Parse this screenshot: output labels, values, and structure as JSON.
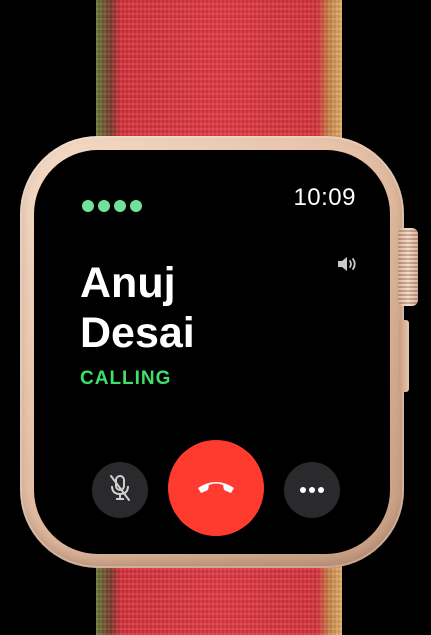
{
  "status_bar": {
    "time": "10:09",
    "signal_bars": 4,
    "signal_color": "#6ee39a"
  },
  "call": {
    "name_first": "Anuj",
    "name_last": "Desai",
    "status": "CALLING",
    "status_color": "#3ee06c"
  },
  "controls": {
    "mute_icon": "microphone-slash-icon",
    "end_icon": "phone-hangup-icon",
    "end_color": "#ff3b30",
    "more_icon": "ellipsis-icon",
    "volume_icon": "speaker-volume-icon"
  },
  "device": {
    "case_color": "#e9c6ad",
    "band_color": "#e23a44"
  }
}
